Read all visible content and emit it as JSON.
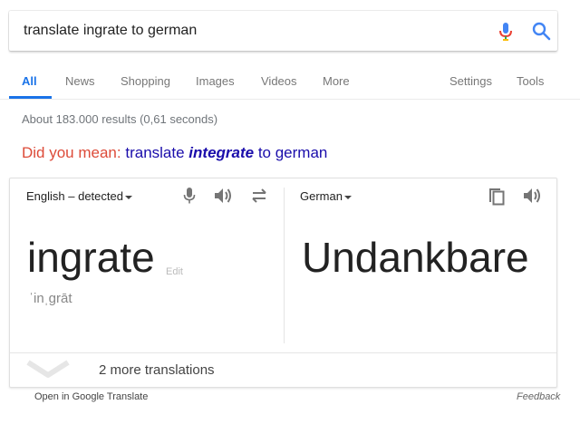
{
  "search": {
    "query": "translate ingrate to german",
    "mic_icon": "microphone-icon",
    "search_icon": "search-icon"
  },
  "tabs": [
    {
      "label": "All",
      "active": true
    },
    {
      "label": "News"
    },
    {
      "label": "Shopping"
    },
    {
      "label": "Images"
    },
    {
      "label": "Videos"
    },
    {
      "label": "More"
    }
  ],
  "tools": {
    "settings": "Settings",
    "tools": "Tools"
  },
  "results_count": "About 183.000 results (0,61 seconds)",
  "did_you_mean": {
    "label": "Did you mean:",
    "prefix": "translate",
    "suggestion": "integrate",
    "suffix": "to german"
  },
  "translate": {
    "source_lang": "English – detected",
    "target_lang": "German",
    "source_word": "ingrate",
    "edit": "Edit",
    "pronunciation": "ˈinˌgrāt",
    "target_word": "Undankbare",
    "more_translations": "2 more translations"
  },
  "footer": {
    "open_link": "Open in Google Translate",
    "feedback": "Feedback"
  },
  "colors": {
    "accent": "#1a73e8",
    "did_you_mean": "#dd4b39",
    "link": "#1a0dab"
  }
}
